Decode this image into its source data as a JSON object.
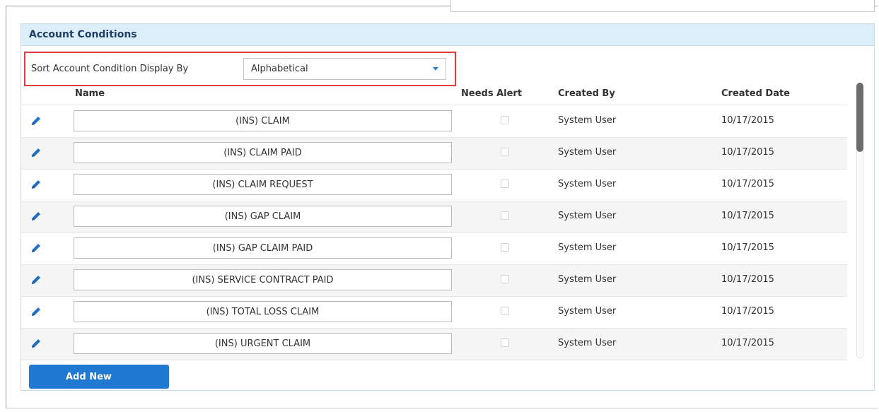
{
  "panel": {
    "title": "Account Conditions"
  },
  "sort": {
    "label": "Sort Account Condition Display By",
    "selected": "Alphabetical",
    "highlight_color": "#e0393e"
  },
  "table": {
    "columns": {
      "name": "Name",
      "needs_alert": "Needs Alert",
      "created_by": "Created By",
      "created_date": "Created Date"
    },
    "rows": [
      {
        "name": "(INS) CLAIM",
        "needs_alert": false,
        "created_by": "System User",
        "created_date": "10/17/2015"
      },
      {
        "name": "(INS) CLAIM PAID",
        "needs_alert": false,
        "created_by": "System User",
        "created_date": "10/17/2015"
      },
      {
        "name": "(INS) CLAIM REQUEST",
        "needs_alert": false,
        "created_by": "System User",
        "created_date": "10/17/2015"
      },
      {
        "name": "(INS) GAP CLAIM",
        "needs_alert": false,
        "created_by": "System User",
        "created_date": "10/17/2015"
      },
      {
        "name": "(INS) GAP CLAIM PAID",
        "needs_alert": false,
        "created_by": "System User",
        "created_date": "10/17/2015"
      },
      {
        "name": "(INS) SERVICE CONTRACT PAID",
        "needs_alert": false,
        "created_by": "System User",
        "created_date": "10/17/2015"
      },
      {
        "name": "(INS) TOTAL LOSS CLAIM",
        "needs_alert": false,
        "created_by": "System User",
        "created_date": "10/17/2015"
      },
      {
        "name": "(INS) URGENT CLAIM",
        "needs_alert": false,
        "created_by": "System User",
        "created_date": "10/17/2015"
      }
    ],
    "row_icon": "pencil-icon"
  },
  "actions": {
    "add_new_label": "Add New"
  },
  "colors": {
    "accent": "#1f78d1",
    "header_bg": "#ddeefb",
    "header_text": "#1f3f68"
  }
}
